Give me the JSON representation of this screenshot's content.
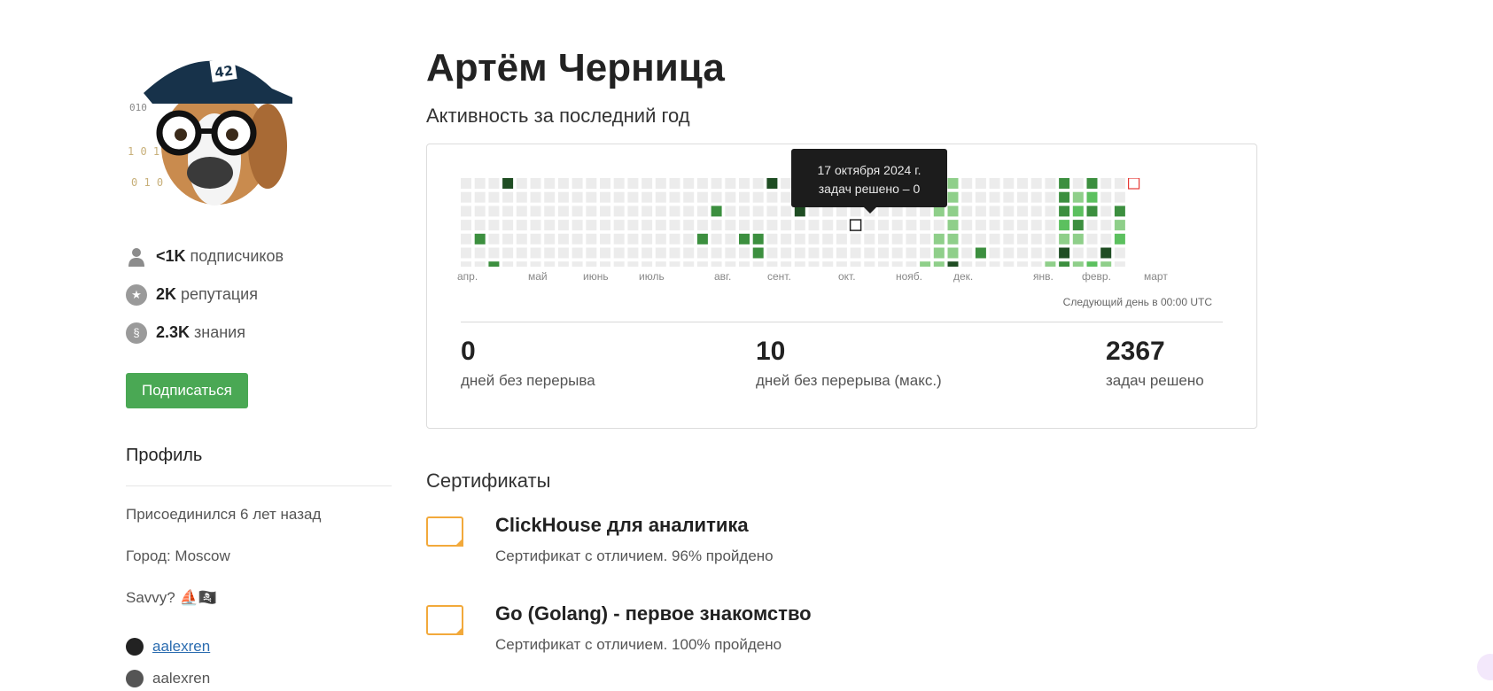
{
  "profile": {
    "name": "Артём Черница",
    "followers_value": "<1K",
    "followers_label": "подписчиков",
    "reputation_value": "2K",
    "reputation_label": "репутация",
    "knowledge_value": "2.3K",
    "knowledge_label": "знания",
    "subscribe_label": "Подписаться",
    "profile_title": "Профиль",
    "joined": "Присоединился 6 лет назад",
    "city": "Город: Moscow",
    "savvy": "Savvy? ⛵🏴‍☠️",
    "github": "aalexren",
    "telegram": "aalexren"
  },
  "activity": {
    "title": "Активность за последний год",
    "months": [
      "апр.",
      "май",
      "июнь",
      "июль",
      "авг.",
      "сент.",
      "окт.",
      "нояб.",
      "дек.",
      "янв.",
      "февр.",
      "март"
    ],
    "next_day": "Следующий день в 00:00 UTC",
    "tooltip_date": "17 октября 2024 г.",
    "tooltip_count": "задач решено – 0",
    "colors": {
      "empty": "#ececec",
      "l1": "#8fcf8a",
      "l2": "#5cc05f",
      "l3": "#3c8f3f",
      "l4": "#1f4d23",
      "today_outline": "#e53935",
      "selected_outline": "#222222"
    },
    "cells": [
      {
        "week": 3,
        "day": 0,
        "level": 4
      },
      {
        "week": 1,
        "day": 4,
        "level": 3
      },
      {
        "week": 2,
        "day": 6,
        "level": 3
      },
      {
        "week": 18,
        "day": 2,
        "level": 3
      },
      {
        "week": 17,
        "day": 4,
        "level": 3
      },
      {
        "week": 20,
        "day": 4,
        "level": 3
      },
      {
        "week": 21,
        "day": 4,
        "level": 3
      },
      {
        "week": 21,
        "day": 5,
        "level": 3
      },
      {
        "week": 22,
        "day": 0,
        "level": 4
      },
      {
        "week": 24,
        "day": 2,
        "level": 4
      },
      {
        "week": 34,
        "day": 1,
        "level": 1
      },
      {
        "week": 34,
        "day": 2,
        "level": 1
      },
      {
        "week": 34,
        "day": 4,
        "level": 1
      },
      {
        "week": 34,
        "day": 5,
        "level": 1
      },
      {
        "week": 34,
        "day": 6,
        "level": 1
      },
      {
        "week": 35,
        "day": 0,
        "level": 1
      },
      {
        "week": 35,
        "day": 1,
        "level": 1
      },
      {
        "week": 35,
        "day": 2,
        "level": 1
      },
      {
        "week": 35,
        "day": 3,
        "level": 1
      },
      {
        "week": 35,
        "day": 4,
        "level": 1
      },
      {
        "week": 35,
        "day": 5,
        "level": 1
      },
      {
        "week": 35,
        "day": 6,
        "level": 4
      },
      {
        "week": 33,
        "day": 6,
        "level": 1
      },
      {
        "week": 37,
        "day": 5,
        "level": 3
      },
      {
        "week": 42,
        "day": 6,
        "level": 1
      },
      {
        "week": 43,
        "day": 0,
        "level": 3
      },
      {
        "week": 43,
        "day": 1,
        "level": 3
      },
      {
        "week": 43,
        "day": 2,
        "level": 3
      },
      {
        "week": 43,
        "day": 3,
        "level": 2
      },
      {
        "week": 43,
        "day": 4,
        "level": 1
      },
      {
        "week": 43,
        "day": 5,
        "level": 4
      },
      {
        "week": 43,
        "day": 6,
        "level": 3
      },
      {
        "week": 44,
        "day": 1,
        "level": 1
      },
      {
        "week": 44,
        "day": 2,
        "level": 2
      },
      {
        "week": 44,
        "day": 3,
        "level": 3
      },
      {
        "week": 44,
        "day": 4,
        "level": 1
      },
      {
        "week": 44,
        "day": 6,
        "level": 1
      },
      {
        "week": 45,
        "day": 0,
        "level": 3
      },
      {
        "week": 45,
        "day": 1,
        "level": 2
      },
      {
        "week": 45,
        "day": 2,
        "level": 3
      },
      {
        "week": 45,
        "day": 6,
        "level": 2
      },
      {
        "week": 46,
        "day": 5,
        "level": 4
      },
      {
        "week": 46,
        "day": 6,
        "level": 1
      },
      {
        "week": 47,
        "day": 2,
        "level": 3
      },
      {
        "week": 47,
        "day": 3,
        "level": 1
      },
      {
        "week": 47,
        "day": 4,
        "level": 2
      }
    ],
    "selected_cell": {
      "week": 28,
      "day": 3
    },
    "today_cell": {
      "week": 48,
      "day": 0
    },
    "streak_current": "0",
    "streak_current_label": "дней без перерыва",
    "streak_max": "10",
    "streak_max_label": "дней без перерыва (макс.)",
    "solved_total": "2367",
    "solved_label": "задач решено"
  },
  "certificates": {
    "title": "Сертификаты",
    "items": [
      {
        "name": "ClickHouse для аналитика",
        "desc": "Сертификат с отличием. 96% пройдено"
      },
      {
        "name": "Go (Golang) - первое знакомство",
        "desc": "Сертификат с отличием. 100% пройдено"
      }
    ]
  }
}
